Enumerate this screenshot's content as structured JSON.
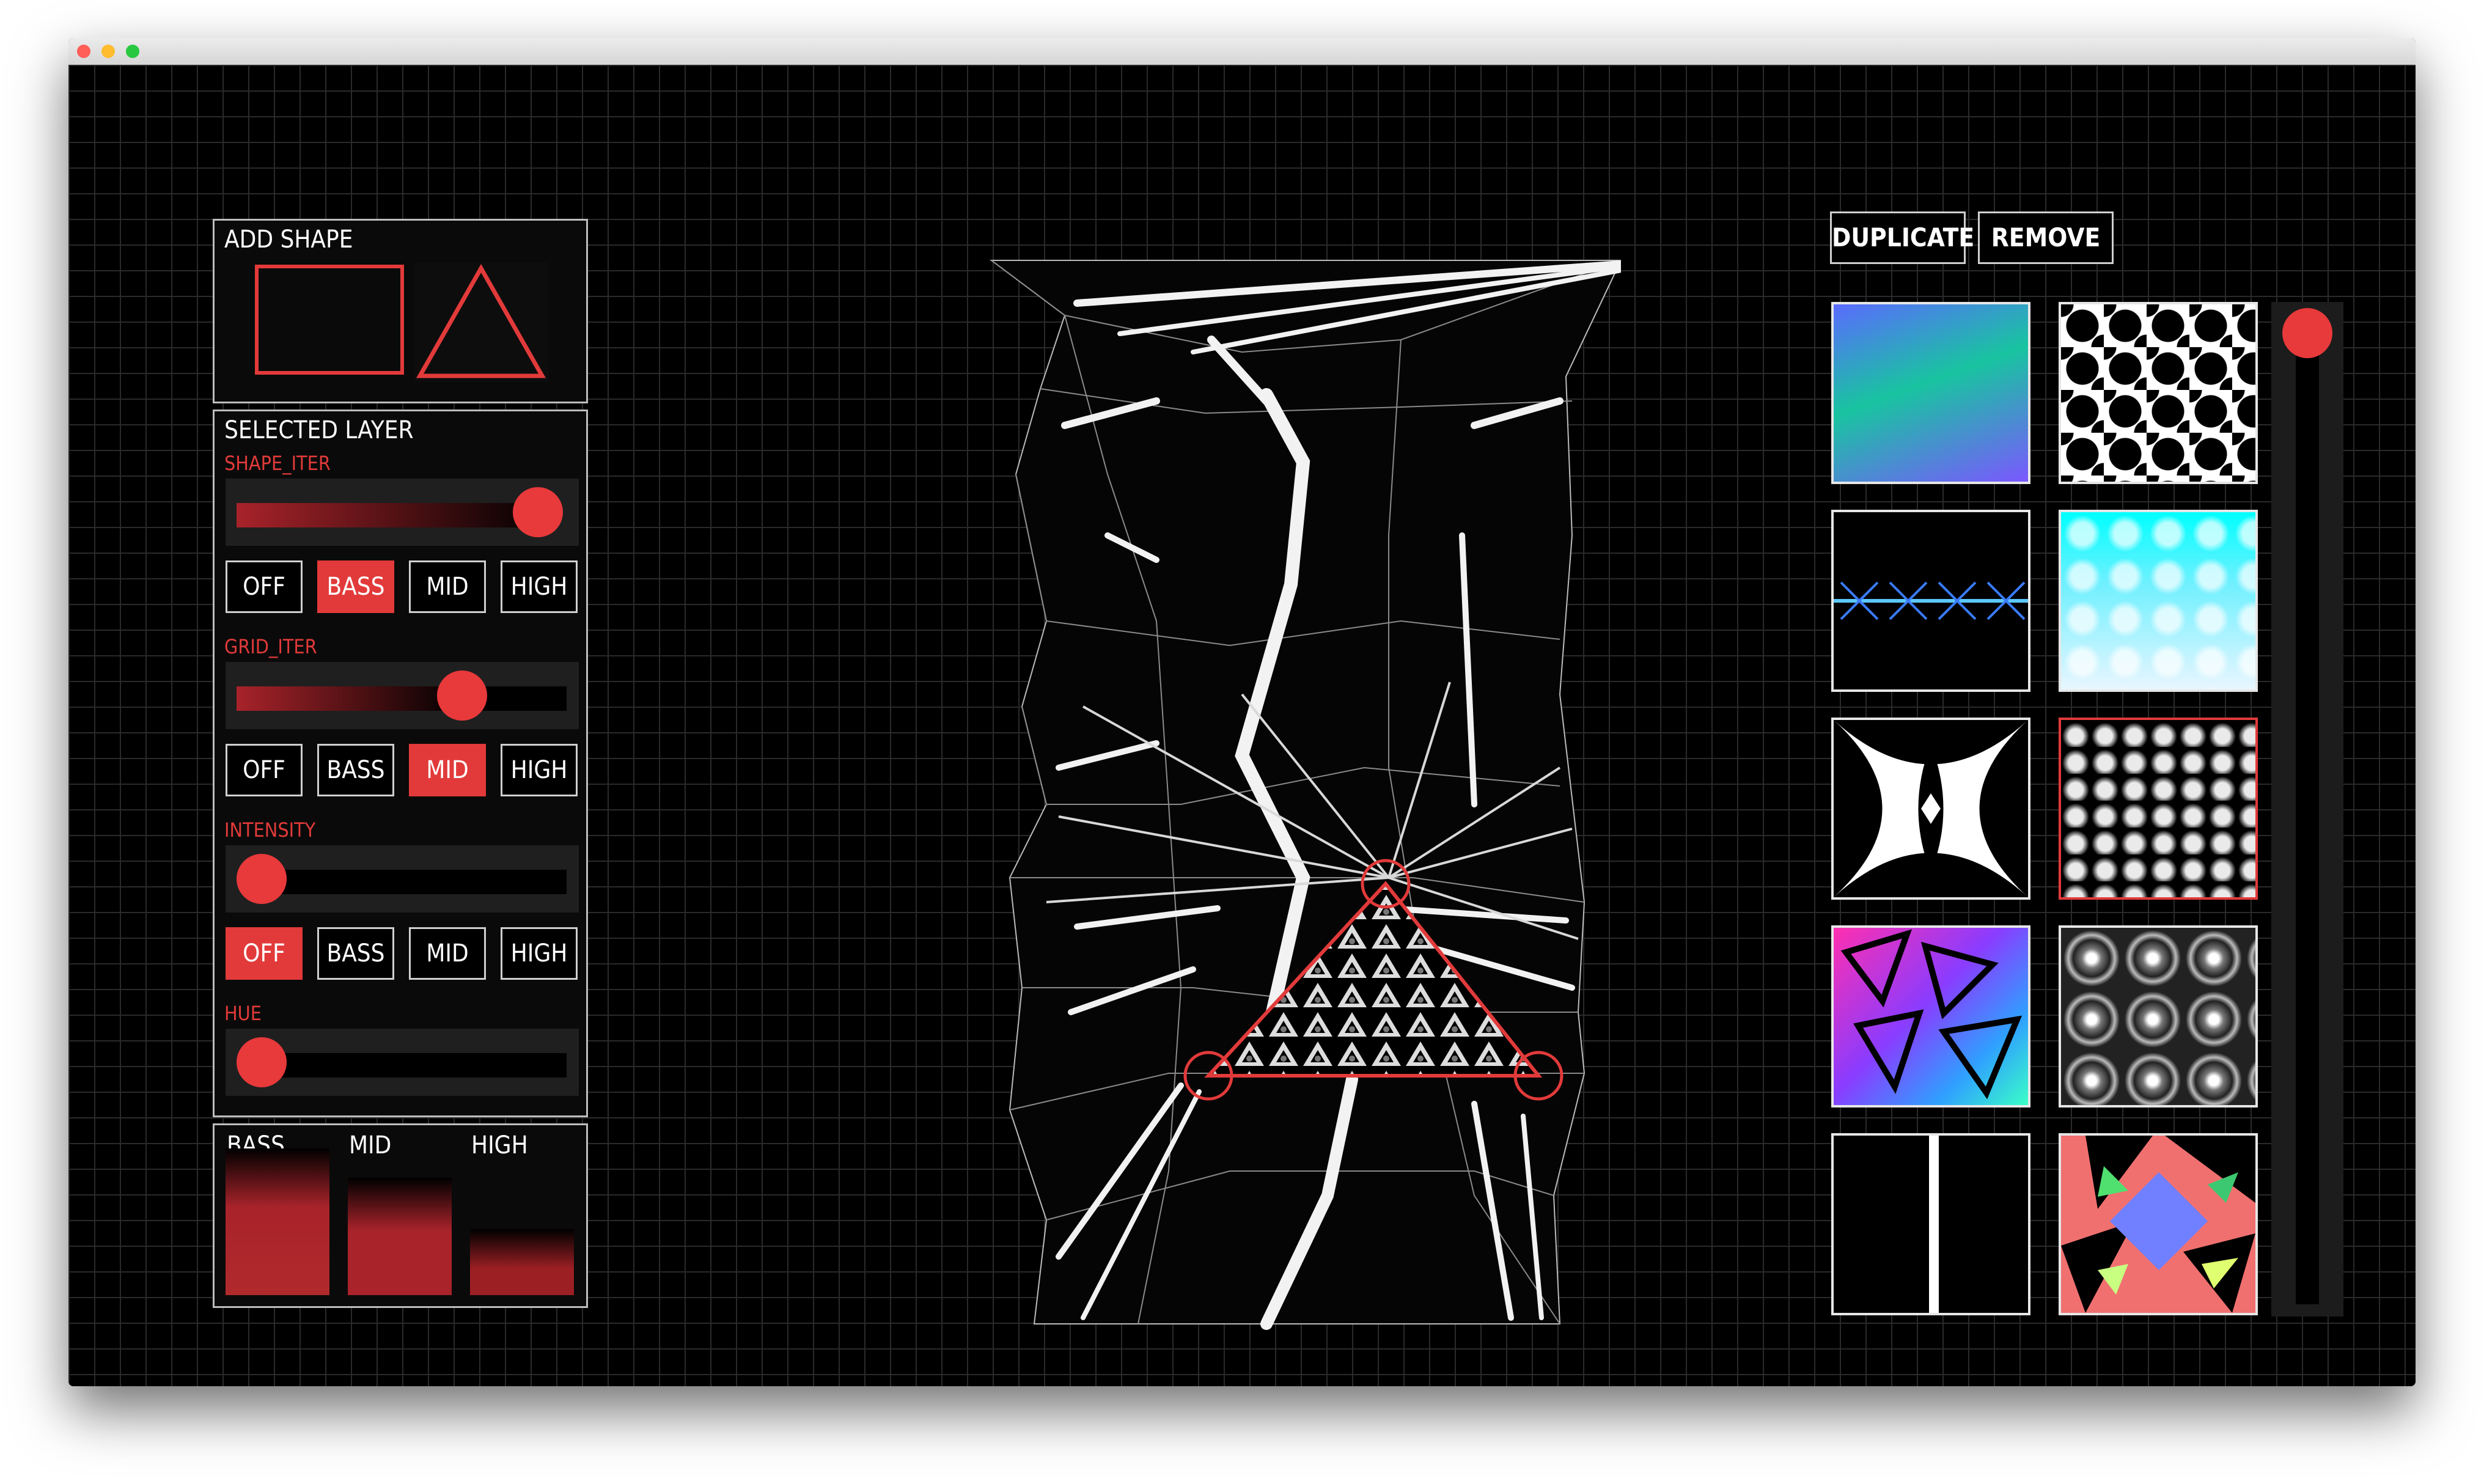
{
  "left_panel": {
    "add_shape_title": "ADD SHAPE",
    "selected_layer_title": "SELECTED LAYER",
    "params": [
      {
        "label": "SHAPE_ITER",
        "value": 0.92,
        "active": "BASS"
      },
      {
        "label": "GRID_ITER",
        "value": 0.7,
        "active": "MID"
      },
      {
        "label": "INTENSITY",
        "value": 0.0,
        "active": "OFF"
      },
      {
        "label": "HUE",
        "value": 0.0,
        "active": ""
      }
    ],
    "modes": [
      "OFF",
      "BASS",
      "MID",
      "HIGH"
    ]
  },
  "meters": {
    "bass_label": "BASS",
    "mid_label": "MID",
    "high_label": "HIGH",
    "bass_level": 0.9,
    "mid_level": 0.72,
    "high_level": 0.4
  },
  "toolbar": {
    "duplicate_label": "DUPLICATE",
    "remove_label": "REMOVE"
  },
  "textures": [
    "gradient",
    "stars",
    "blue-x-line",
    "cyan-glow",
    "curved-diamond",
    "triangles",
    "colored-triangles",
    "swirls",
    "white-line",
    "color-shards"
  ],
  "selected_texture": "triangles",
  "vertical_slider_value": 1.0,
  "colors": {
    "accent": "#e23a3a",
    "border": "#bdbdbd",
    "background": "#000000",
    "grid": "#2a2a2a"
  }
}
